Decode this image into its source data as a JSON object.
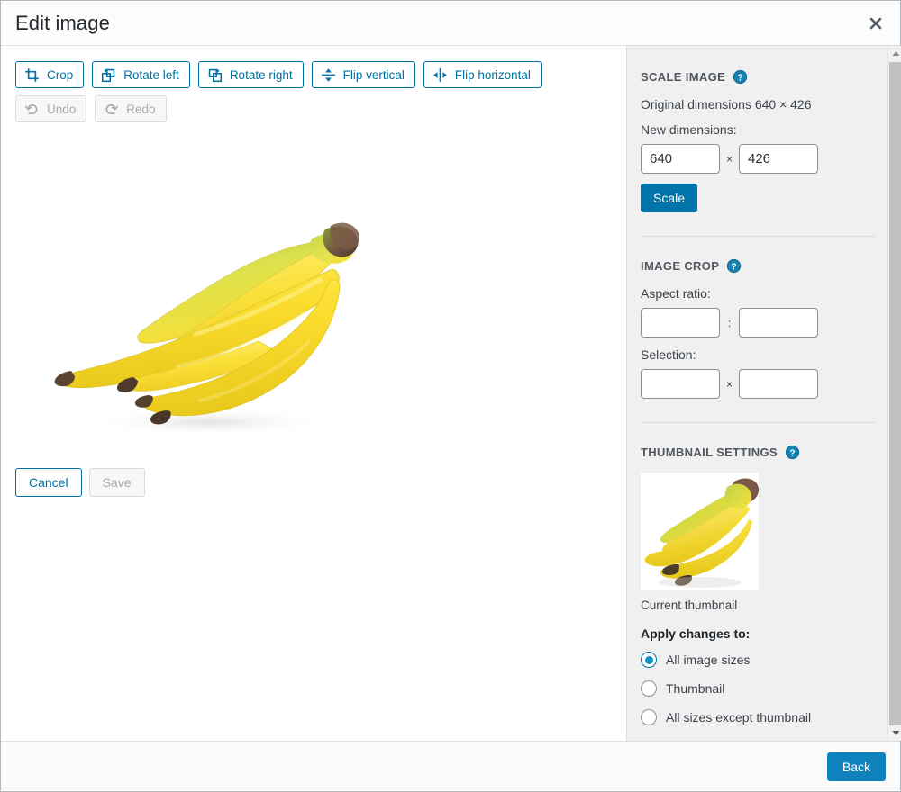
{
  "modal": {
    "title": "Edit image",
    "close_icon": "close-icon"
  },
  "toolbar": {
    "row1": [
      {
        "label": "Crop",
        "icon": "crop-icon",
        "disabled": false
      },
      {
        "label": "Rotate left",
        "icon": "rotate-left-icon",
        "disabled": false
      },
      {
        "label": "Rotate right",
        "icon": "rotate-right-icon",
        "disabled": false
      },
      {
        "label": "Flip vertical",
        "icon": "flip-vertical-icon",
        "disabled": false
      },
      {
        "label": "Flip horizontal",
        "icon": "flip-horizontal-icon",
        "disabled": false
      }
    ],
    "row2": [
      {
        "label": "Undo",
        "icon": "undo-icon",
        "disabled": true
      },
      {
        "label": "Redo",
        "icon": "redo-icon",
        "disabled": true
      }
    ]
  },
  "editor": {
    "image_alt": "bunch-of-bananas",
    "cancel_label": "Cancel",
    "save_label": "Save",
    "save_disabled": true
  },
  "scale_image": {
    "section_title": "SCALE IMAGE",
    "help_icon": "help-icon",
    "original_dimensions_text": "Original dimensions 640 × 426",
    "new_dimensions_label": "New dimensions:",
    "width_value": "640",
    "height_value": "426",
    "separator": "×",
    "scale_button_label": "Scale"
  },
  "image_crop": {
    "section_title": "IMAGE CROP",
    "help_icon": "help-icon",
    "aspect_ratio_label": "Aspect ratio:",
    "aspect_ratio_width": "",
    "aspect_ratio_height": "",
    "aspect_separator": ":",
    "selection_label": "Selection:",
    "selection_width": "",
    "selection_height": "",
    "selection_separator": "×"
  },
  "thumbnail_settings": {
    "section_title": "THUMBNAIL SETTINGS",
    "help_icon": "help-icon",
    "thumbnail_alt": "bunch-of-bananas-thumbnail",
    "thumbnail_caption": "Current thumbnail",
    "apply_label": "Apply changes to:",
    "options": [
      {
        "label": "All image sizes",
        "checked": true
      },
      {
        "label": "Thumbnail",
        "checked": false
      },
      {
        "label": "All sizes except thumbnail",
        "checked": false
      }
    ]
  },
  "footer": {
    "back_label": "Back"
  },
  "colors": {
    "accent_blue": "#0073aa",
    "link_blue": "#0071a1",
    "primary_button": "#0f82bd",
    "radio_fill": "#0f93c8",
    "sidebar_bg": "#f0f0f1",
    "disabled_text": "#a7aaad"
  }
}
